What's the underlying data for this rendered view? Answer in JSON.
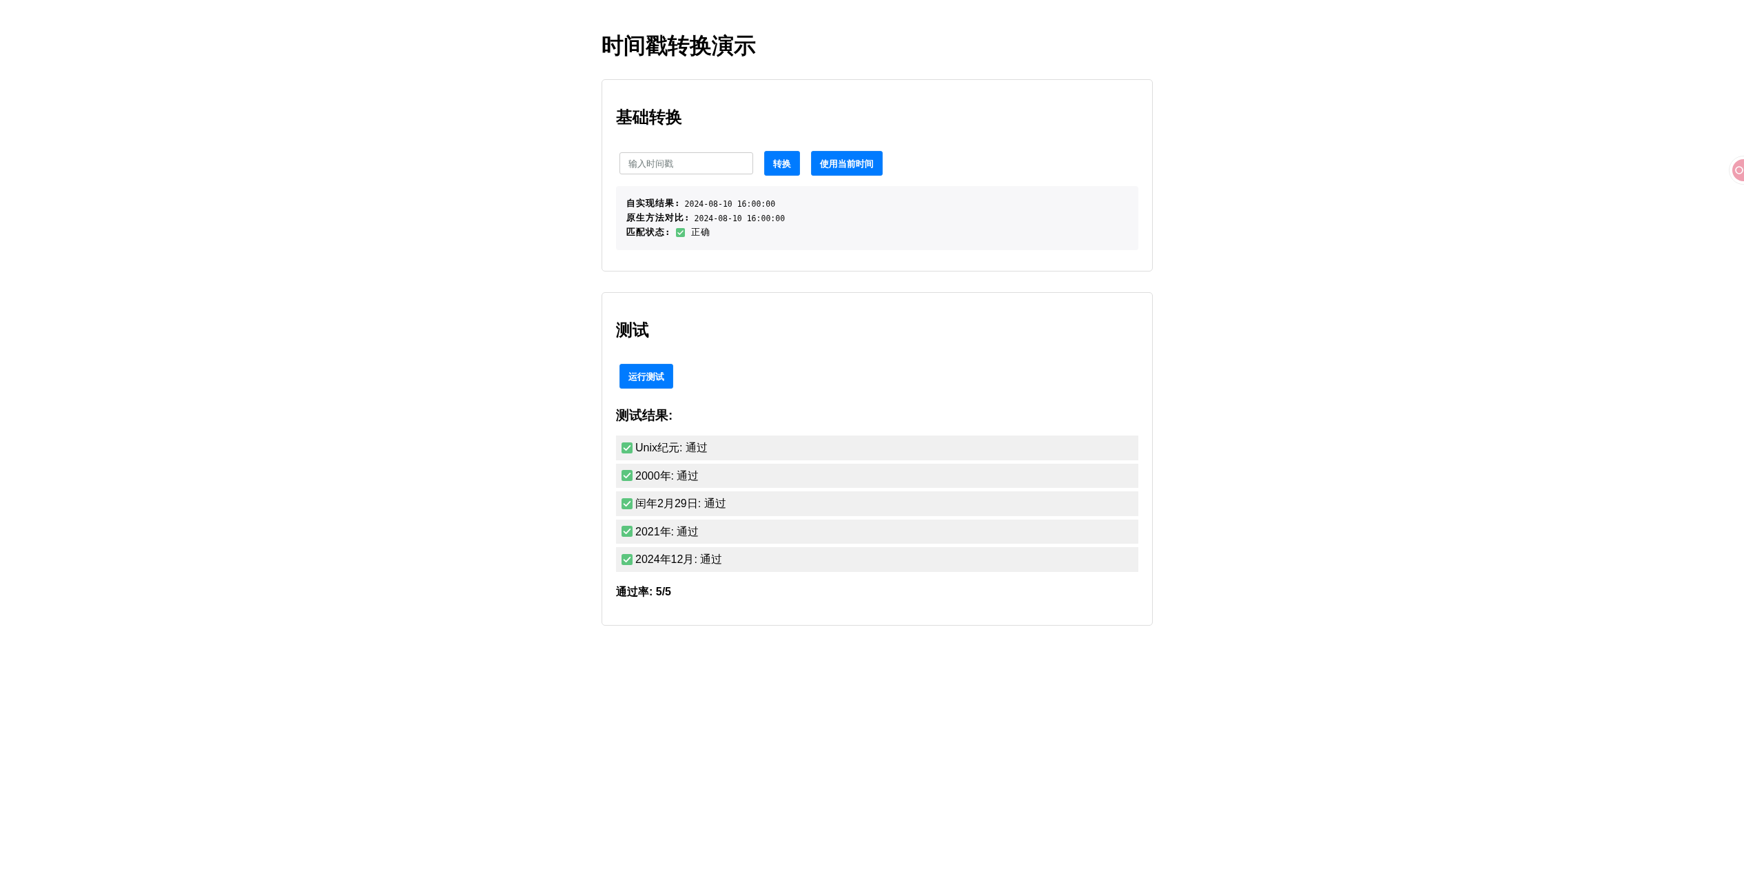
{
  "title": "时间戳转换演示",
  "basic": {
    "heading": "基础转换",
    "input": {
      "placeholder": "输入时间戳"
    },
    "buttons": [
      "转换",
      "使用当前时间"
    ],
    "results": [
      {
        "label": "自实现结果:",
        "value": "2024-08-10 16:00:00"
      },
      {
        "label": "原生方法对比:",
        "value": "2024-08-10 16:00:00"
      }
    ],
    "match": {
      "label": "匹配状态:",
      "ok": true,
      "value": "正确"
    }
  },
  "tests": {
    "heading": "测试",
    "button": "运行测试",
    "results_heading": "测试结果:",
    "items": [
      {
        "text": "Unix纪元: 通过",
        "passed": true
      },
      {
        "text": "2000年: 通过",
        "passed": true
      },
      {
        "text": "闰年2月29日: 通过",
        "passed": true
      },
      {
        "text": "2021年: 通过",
        "passed": true
      },
      {
        "text": "2024年12月: 通过",
        "passed": true
      }
    ],
    "pass_rate": "通过率: 5/5"
  }
}
